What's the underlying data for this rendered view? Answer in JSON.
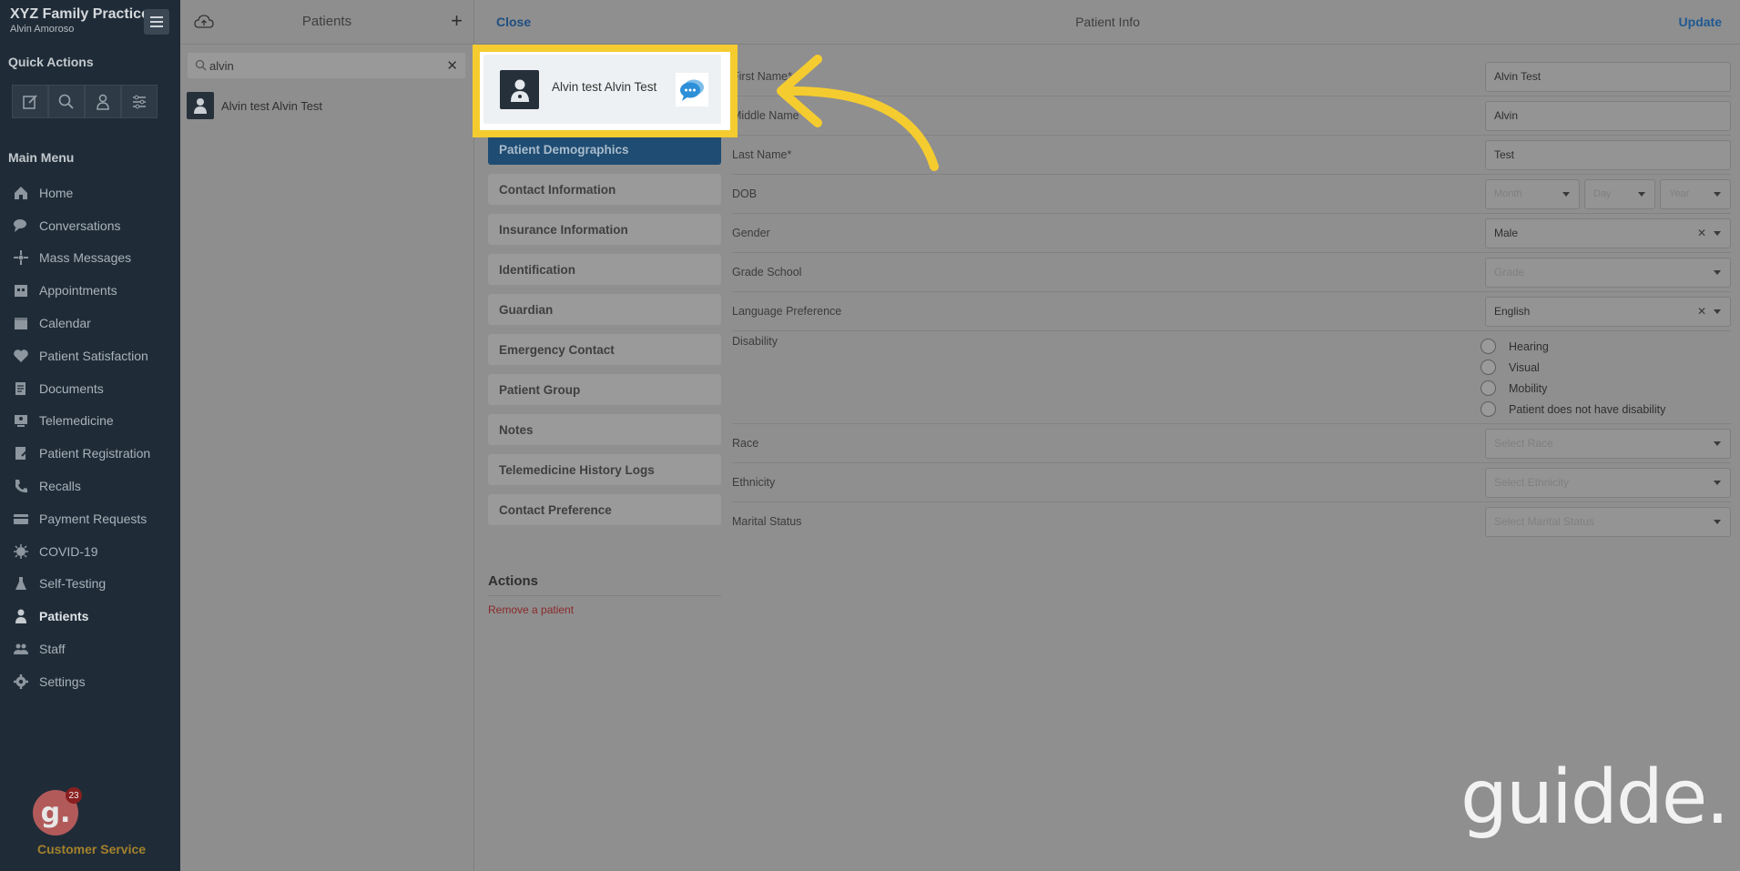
{
  "sidebar": {
    "brand_title": "XYZ Family Practice",
    "brand_user": "Alvin Amoroso",
    "quick_actions_title": "Quick Actions",
    "quick_actions": [
      "compose-icon",
      "search-icon",
      "doctor-icon",
      "sliders-icon"
    ],
    "main_menu_title": "Main Menu",
    "items": [
      {
        "label": "Home",
        "icon": "home-icon"
      },
      {
        "label": "Conversations",
        "icon": "chat-icon"
      },
      {
        "label": "Mass Messages",
        "icon": "broadcast-icon"
      },
      {
        "label": "Appointments",
        "icon": "appointment-icon"
      },
      {
        "label": "Calendar",
        "icon": "calendar-icon"
      },
      {
        "label": "Patient Satisfaction",
        "icon": "heart-icon"
      },
      {
        "label": "Documents",
        "icon": "document-icon"
      },
      {
        "label": "Telemedicine",
        "icon": "telemedicine-icon"
      },
      {
        "label": "Patient Registration",
        "icon": "registration-icon"
      },
      {
        "label": "Recalls",
        "icon": "phone-icon"
      },
      {
        "label": "Payment Requests",
        "icon": "card-icon"
      },
      {
        "label": "COVID-19",
        "icon": "virus-icon"
      },
      {
        "label": "Self-Testing",
        "icon": "flask-icon"
      },
      {
        "label": "Patients",
        "icon": "patient-icon"
      },
      {
        "label": "Staff",
        "icon": "staff-icon"
      },
      {
        "label": "Settings",
        "icon": "gear-icon"
      }
    ],
    "active_item": "Patients",
    "customer_service": {
      "label": "Customer Service",
      "logo_letter": "g.",
      "badge": "23"
    }
  },
  "patients_panel": {
    "title": "Patients",
    "search_value": "alvin",
    "results": [
      {
        "name": "Alvin test Alvin Test"
      }
    ]
  },
  "main": {
    "close_label": "Close",
    "title": "Patient Info",
    "update_label": "Update",
    "tabs": [
      "Patient Demographics",
      "Contact Information",
      "Insurance Information",
      "Identification",
      "Guardian",
      "Emergency Contact",
      "Patient Group",
      "Notes",
      "Telemedicine History Logs",
      "Contact Preference"
    ],
    "active_tab": "Patient Demographics",
    "actions_title": "Actions",
    "remove_label": "Remove a patient",
    "form": {
      "first_name": {
        "label": "First Name*",
        "value": "Alvin Test"
      },
      "middle_name": {
        "label": "Middle Name",
        "value": "Alvin"
      },
      "last_name": {
        "label": "Last Name*",
        "value": "Test"
      },
      "dob": {
        "label": "DOB",
        "month": "Month",
        "day": "Day",
        "year": "Year"
      },
      "gender": {
        "label": "Gender",
        "value": "Male"
      },
      "grade_school": {
        "label": "Grade School",
        "placeholder": "Grade"
      },
      "language": {
        "label": "Language Preference",
        "value": "English"
      },
      "disability": {
        "label": "Disability",
        "options": [
          "Hearing",
          "Visual",
          "Mobility",
          "Patient does not have disability"
        ]
      },
      "race": {
        "label": "Race",
        "placeholder": "Select Race"
      },
      "ethnicity": {
        "label": "Ethnicity",
        "placeholder": "Select Ethnicity"
      },
      "marital": {
        "label": "Marital Status",
        "placeholder": "Select Marital Status"
      }
    }
  },
  "highlight": {
    "name": "Alvin test Alvin Test",
    "border_color": "#f5cc2f",
    "icons": [
      "patient-icon",
      "chat-bubbles-icon"
    ]
  },
  "watermark": "guidde."
}
